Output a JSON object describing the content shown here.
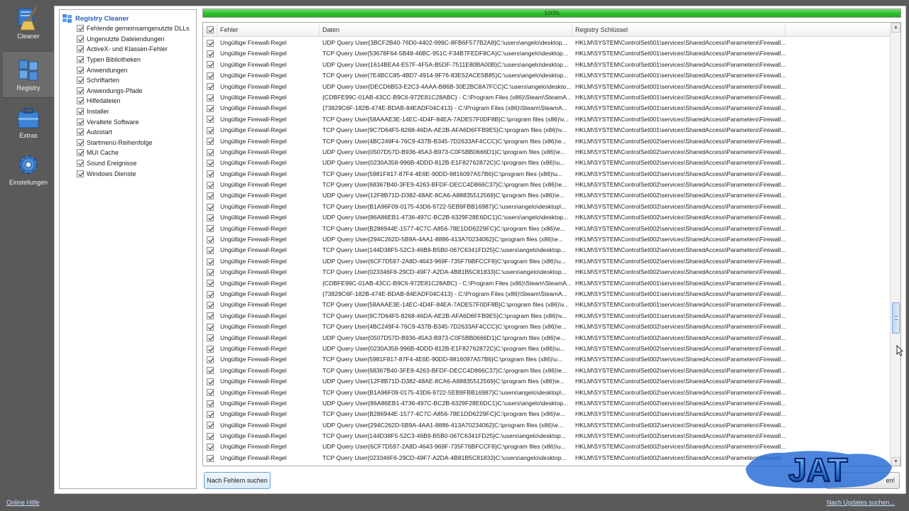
{
  "nav": [
    {
      "label": "Cleaner",
      "icon": "broom-icon",
      "active": false
    },
    {
      "label": "Registry",
      "icon": "registry-cubes-icon",
      "active": true
    },
    {
      "label": "Extras",
      "icon": "toolbox-icon",
      "active": false
    },
    {
      "label": "Einstellungen",
      "icon": "gear-icon",
      "active": false
    }
  ],
  "tree": {
    "root": "Registry Cleaner",
    "items": [
      "Fehlende gemeinsamgenutzte DLLs",
      "Ungenutzte Dateiendungen",
      "ActiveX- und Klassen-Fehler",
      "Typen Bibliotheken",
      "Anwendungen",
      "Schriftarten",
      "Anwendungs-Pfade",
      "Hilfedateien",
      "Installer",
      "Veraltete Software",
      "Autostart",
      "Startmenü-Reihenfolge",
      "MUI Cache",
      "Sound Ereignisse",
      "Windows Dienste"
    ]
  },
  "progress": {
    "percent": 100,
    "label": "100%"
  },
  "table": {
    "columns": [
      "Fehler",
      "Daten",
      "Registry Schlüssel"
    ],
    "rows": [
      [
        "Ungültige Firewall-Regel",
        "UDP Query User{3BCF2B40-76D0-4402-999C-8FB6F577B2A8}C:\\users\\angelo\\desktop...",
        "HKLM\\SYSTEM\\ControlSet001\\services\\SharedAccess\\Parameters\\Firewall..."
      ],
      [
        "Ungültige Firewall-Regel",
        "TCP Query User{53678F64-5B48-46BC-951C-F34B7FEDF8CA}C:\\users\\angelo\\desktop...",
        "HKLM\\SYSTEM\\ControlSet001\\services\\SharedAccess\\Parameters\\Firewall..."
      ],
      [
        "Ungültige Firewall-Regel",
        "UDP Query User{1614BEA4-E57F-4F5A-B5DF-7511E80BA00B}C:\\users\\angelo\\desktop...",
        "HKLM\\SYSTEM\\ControlSet001\\services\\SharedAccess\\Parameters\\Firewall..."
      ],
      [
        "Ungültige Firewall-Regel",
        "TCP Query User{7E4BCC85-4BD7-4914-9F76-83E52ACE5B85}C:\\users\\angelo\\desktop...",
        "HKLM\\SYSTEM\\ControlSet001\\services\\SharedAccess\\Parameters\\Firewall..."
      ],
      [
        "Ungültige Firewall-Regel",
        "UDP Query User{DECD6B53-E2C3-4AAA-B86B-30E2BC8A7FCC}C:\\users\\angelo\\deskto...",
        "HKLM\\SYSTEM\\ControlSet001\\services\\SharedAccess\\Parameters\\Firewall..."
      ],
      [
        "Ungültige Firewall-Regel",
        "{CDBFE99C-01AB-43CC-B9C6-972E81C28ABC} - C:\\Program Files (x86)\\Steam\\SteamA...",
        "HKLM\\SYSTEM\\ControlSet001\\services\\SharedAccess\\Parameters\\Firewall..."
      ],
      [
        "Ungültige Firewall-Regel",
        "{73829C6F-182B-474E-BDAB-84EADF04C413} - C:\\Program Files (x86)\\Steam\\SteamA...",
        "HKLM\\SYSTEM\\ControlSet001\\services\\SharedAccess\\Parameters\\Firewall..."
      ],
      [
        "Ungültige Firewall-Regel",
        "TCP Query User{58AAAE3E-14EC-4D4F-84EA-7ADE57F0DF8B}C:\\program files (x86)\\v...",
        "HKLM\\SYSTEM\\ControlSet001\\services\\SharedAccess\\Parameters\\Firewall..."
      ],
      [
        "Ungültige Firewall-Regel",
        "TCP Query User{9C7D64F5-8268-46DA-AE2B-AFA6D6FFB9E5}C:\\program files (x86)\\v...",
        "HKLM\\SYSTEM\\ControlSet001\\services\\SharedAccess\\Parameters\\Firewall..."
      ],
      [
        "Ungültige Firewall-Regel",
        "TCP Query User{4BC249F4-76C9-437B-B345-7D2633AF4CCC}C:\\program files (x86)\\e...",
        "HKLM\\SYSTEM\\ControlSet002\\services\\SharedAccess\\Parameters\\Firewall..."
      ],
      [
        "Ungültige Firewall-Regel",
        "UDP Query User{0507D57D-B936-45A3-B973-C0F5BB0666D1}C:\\program files (x86)\\e...",
        "HKLM\\SYSTEM\\ControlSet002\\services\\SharedAccess\\Parameters\\Firewall..."
      ],
      [
        "Ungültige Firewall-Regel",
        "UDP Query User{0230A358-996B-4DDD-812B-E1F82762872C}C:\\program files (x86)\\u...",
        "HKLM\\SYSTEM\\ControlSet002\\services\\SharedAccess\\Parameters\\Firewall..."
      ],
      [
        "Ungültige Firewall-Regel",
        "TCP Query User{5981F817-87F4-4E6E-90DD-9816097A57B6}C:\\program files (x86)\\u...",
        "HKLM\\SYSTEM\\ControlSet002\\services\\SharedAccess\\Parameters\\Firewall..."
      ],
      [
        "Ungültige Firewall-Regel",
        "TCP Query User{68367B40-3FE9-4263-BFDF-DECC4D866C37}C:\\program files (x86)\\e...",
        "HKLM\\SYSTEM\\ControlSet002\\services\\SharedAccess\\Parameters\\Firewall..."
      ],
      [
        "Ungültige Firewall-Regel",
        "UDP Query User{12F8B71D-D382-48AE-8CA6-A88835512569}C:\\program files (x86)\\e...",
        "HKLM\\SYSTEM\\ControlSet002\\services\\SharedAccess\\Parameters\\Firewall..."
      ],
      [
        "Ungültige Firewall-Regel",
        "TCP Query User{B1A96F09-0175-43D6-9722-5EB9FBB16987}C:\\users\\angelo\\desktop\\...",
        "HKLM\\SYSTEM\\ControlSet002\\services\\SharedAccess\\Parameters\\Firewall..."
      ],
      [
        "Ungültige Firewall-Regel",
        "UDP Query User{86A86EB1-4736-497C-BC2B-6329F28E6DC1}C:\\users\\angelo\\desktop...",
        "HKLM\\SYSTEM\\ControlSet002\\services\\SharedAccess\\Parameters\\Firewall..."
      ],
      [
        "Ungültige Firewall-Regel",
        "TCP Query User{B286944E-1577-4C7C-A856-78E1DD6229FC}C:\\program files (x86)\\e...",
        "HKLM\\SYSTEM\\ControlSet002\\services\\SharedAccess\\Parameters\\Firewall..."
      ],
      [
        "Ungültige Firewall-Regel",
        "UDP Query User{294C262D-5B9A-4AA1-8886-413A70234062}C:\\program files (x86)\\e...",
        "HKLM\\SYSTEM\\ControlSet002\\services\\SharedAccess\\Parameters\\Firewall..."
      ],
      [
        "Ungültige Firewall-Regel",
        "TCP Query User{144D38F5-52C3-46B9-B5B0-067C6341FD25}C:\\users\\angelo\\desktop...",
        "HKLM\\SYSTEM\\ControlSet002\\services\\SharedAccess\\Parameters\\Firewall..."
      ],
      [
        "Ungültige Firewall-Regel",
        "UDP Query User{6CF7D597-2A8D-4643-969F-735F76BFCCF8}C:\\program files (x86)\\u...",
        "HKLM\\SYSTEM\\ControlSet002\\services\\SharedAccess\\Parameters\\Firewall..."
      ],
      [
        "Ungültige Firewall-Regel",
        "TCP Query User{023346F6-29CD-49F7-A2DA-4B81B5C81833}C:\\users\\angelo\\desktop...",
        "HKLM\\SYSTEM\\ControlSet002\\services\\SharedAccess\\Parameters\\Firewall..."
      ],
      [
        "Ungültige Firewall-Regel",
        "{CDBFE99C-01AB-43CC-B9C6-972E81C28ABC} - C:\\Program Files (x86)\\Steam\\SteamA...",
        "HKLM\\SYSTEM\\ControlSet001\\services\\SharedAccess\\Parameters\\Firewall..."
      ],
      [
        "Ungültige Firewall-Regel",
        "{73829C6F-182B-474E-BDAB-84EADF04C413} - C:\\Program Files (x86)\\Steam\\SteamA...",
        "HKLM\\SYSTEM\\ControlSet001\\services\\SharedAccess\\Parameters\\Firewall..."
      ],
      [
        "Ungültige Firewall-Regel",
        "TCP Query User{58AAAE3E-14EC-4D4F-84EA-7ADE57F0DF8B}C:\\program files (x86)\\v...",
        "HKLM\\SYSTEM\\ControlSet001\\services\\SharedAccess\\Parameters\\Firewall..."
      ],
      [
        "Ungültige Firewall-Regel",
        "TCP Query User{9C7D64F5-8268-46DA-AE2B-AFA6D6FFB9E5}C:\\program files (x86)\\v...",
        "HKLM\\SYSTEM\\ControlSet001\\services\\SharedAccess\\Parameters\\Firewall..."
      ],
      [
        "Ungültige Firewall-Regel",
        "TCP Query User{4BC249F4-76C9-437B-B345-7D2633AF4CCC}C:\\program files (x86)\\e...",
        "HKLM\\SYSTEM\\ControlSet002\\services\\SharedAccess\\Parameters\\Firewall..."
      ],
      [
        "Ungültige Firewall-Regel",
        "UDP Query User{0507D57D-B936-45A3-B973-C0F5BB0666D1}C:\\program files (x86)\\e...",
        "HKLM\\SYSTEM\\ControlSet002\\services\\SharedAccess\\Parameters\\Firewall..."
      ],
      [
        "Ungültige Firewall-Regel",
        "UDP Query User{0230A358-996B-4DDD-812B-E1F82762872C}C:\\program files (x86)\\u...",
        "HKLM\\SYSTEM\\ControlSet002\\services\\SharedAccess\\Parameters\\Firewall..."
      ],
      [
        "Ungültige Firewall-Regel",
        "TCP Query User{5981F817-87F4-4E6E-90DD-9816097A57B6}C:\\program files (x86)\\u...",
        "HKLM\\SYSTEM\\ControlSet002\\services\\SharedAccess\\Parameters\\Firewall..."
      ],
      [
        "Ungültige Firewall-Regel",
        "TCP Query User{68367B40-3FE9-4263-BFDF-DECC4D866C37}C:\\program files (x86)\\e...",
        "HKLM\\SYSTEM\\ControlSet002\\services\\SharedAccess\\Parameters\\Firewall..."
      ],
      [
        "Ungültige Firewall-Regel",
        "UDP Query User{12F8B71D-D382-48AE-8CA6-A88835512569}C:\\program files (x86)\\e...",
        "HKLM\\SYSTEM\\ControlSet002\\services\\SharedAccess\\Parameters\\Firewall..."
      ],
      [
        "Ungültige Firewall-Regel",
        "TCP Query User{B1A96F09-0175-43D6-9722-5EB9FBB16987}C:\\users\\angelo\\desktop\\...",
        "HKLM\\SYSTEM\\ControlSet002\\services\\SharedAccess\\Parameters\\Firewall..."
      ],
      [
        "Ungültige Firewall-Regel",
        "UDP Query User{86A86EB1-4736-497C-BC2B-6329F28E6DC1}C:\\users\\angelo\\desktop...",
        "HKLM\\SYSTEM\\ControlSet002\\services\\SharedAccess\\Parameters\\Firewall..."
      ],
      [
        "Ungültige Firewall-Regel",
        "TCP Query User{B286944E-1577-4C7C-A856-78E1DD6229FC}C:\\program files (x86)\\e...",
        "HKLM\\SYSTEM\\ControlSet002\\services\\SharedAccess\\Parameters\\Firewall..."
      ],
      [
        "Ungültige Firewall-Regel",
        "UDP Query User{294C262D-5B9A-4AA1-8886-413A70234062}C:\\program files (x86)\\e...",
        "HKLM\\SYSTEM\\ControlSet002\\services\\SharedAccess\\Parameters\\Firewall..."
      ],
      [
        "Ungültige Firewall-Regel",
        "TCP Query User{144D38F5-52C3-46B9-B5B0-067C6341FD25}C:\\users\\angelo\\desktop...",
        "HKLM\\SYSTEM\\ControlSet002\\services\\SharedAccess\\Parameters\\Firewall..."
      ],
      [
        "Ungültige Firewall-Regel",
        "UDP Query User{6CF7D597-2A8D-4643-969F-735F76BFCCF8}C:\\program files (x86)\\u...",
        "HKLM\\SYSTEM\\ControlSet002\\services\\SharedAccess\\Parameters\\Firewall..."
      ],
      [
        "Ungültige Firewall-Regel",
        "TCP Query User{023346F6-29CD-49F7-A2DA-4B81B5C81833}C:\\users\\angelo\\desktop...",
        "HKLM\\SYSTEM\\ControlSet002\\services\\SharedAccess\\Parameters\\Firewall..."
      ]
    ]
  },
  "buttons": {
    "scan": "Nach Fehlern suchen",
    "fix_partial": "en!"
  },
  "logo": {
    "text": "JAT",
    "icon": "jat-logo-icon"
  },
  "footer": {
    "help": "Online Hilfe",
    "updates": "Nach Updates suchen..."
  },
  "colors": {
    "accent": "#2a5db0",
    "progress": "#2fc22f",
    "background": "#5a5a5a"
  }
}
